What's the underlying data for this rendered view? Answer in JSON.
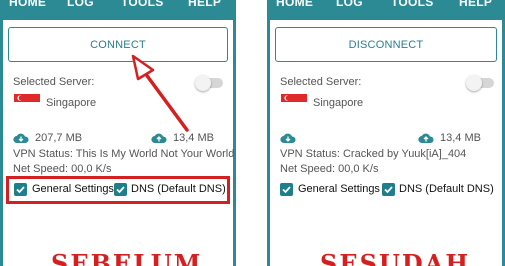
{
  "left": {
    "nav": [
      "HOME",
      "LOG",
      "TOOLS",
      "HELP"
    ],
    "button": "CONNECT",
    "server_label": "Selected Server:",
    "server_name": "Singapore",
    "download": "207,7 MB",
    "upload": "13,4 MB",
    "vpn_status": "VPN Status: This Is My World Not Your World",
    "net_speed": "Net Speed: 00,0 K/s",
    "general_settings": "General Settings",
    "dns": "DNS (Default DNS)",
    "stamp": "SEBELUM"
  },
  "right": {
    "nav": [
      "HOME",
      "LOG",
      "TOOLS",
      "HELP"
    ],
    "button": "DISCONNECT",
    "server_label": "Selected Server:",
    "server_name": "Singapore",
    "upload": "13,4 MB",
    "vpn_status": "VPN Status:  Cracked by Yuuk[iA]_404",
    "net_speed": "Net Speed: 00,0 K/s",
    "general_settings": "General Settings",
    "dns": "DNS (Default DNS)",
    "stamp": "SESUDAH"
  },
  "colors": {
    "teal": "#2c8a95",
    "checkbox": "#1f7e8c",
    "annotation_red": "#d42020"
  },
  "icons": [
    "cloud-download-icon",
    "cloud-upload-icon",
    "singapore-flag-icon",
    "checkmark-icon",
    "annotation-arrow-icon"
  ]
}
